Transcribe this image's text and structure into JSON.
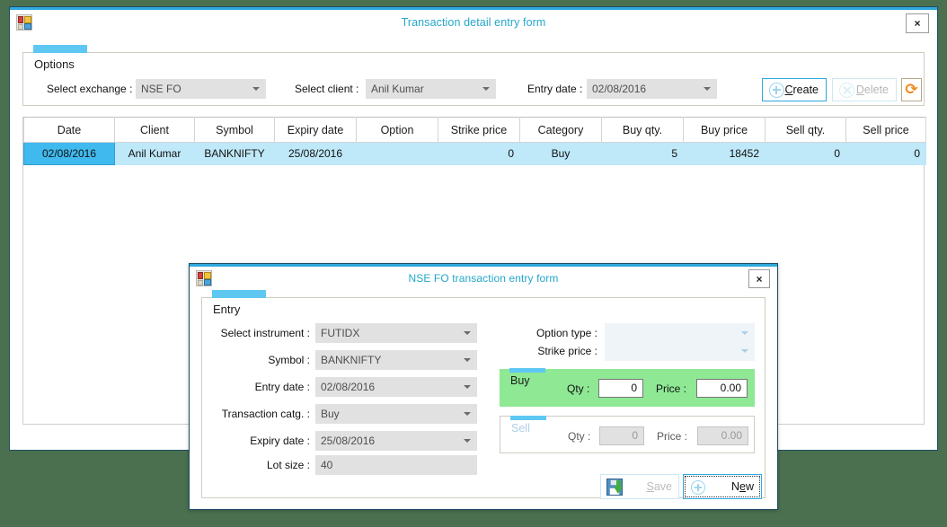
{
  "main_window": {
    "title": "Transaction detail entry form",
    "icon": "vb-form-icon",
    "close_label": "×",
    "options_panel": {
      "tab_label": "Options",
      "fields": [
        {
          "label": "Select exchange :",
          "value": "NSE FO"
        },
        {
          "label": "Select client :",
          "value": "Anil Kumar"
        },
        {
          "label": "Entry date :",
          "value": "02/08/2016"
        }
      ],
      "buttons": {
        "create": {
          "label_pre": "",
          "label_mnemonic": "C",
          "label_post": "reate",
          "icon": "plus-circle-icon"
        },
        "delete": {
          "label_pre": "",
          "label_mnemonic": "D",
          "label_post": "elete",
          "icon": "cross-circle-icon"
        },
        "refresh": {
          "icon": "refresh-icon",
          "glyph": "⟳"
        }
      }
    },
    "grid": {
      "columns": [
        "Date",
        "Client",
        "Symbol",
        "Expiry date",
        "Option",
        "Strike price",
        "Category",
        "Buy qty.",
        "Buy price",
        "Sell qty.",
        "Sell price"
      ],
      "rows": [
        {
          "date": "02/08/2016",
          "client": "Anil Kumar",
          "symbol": "BANKNIFTY",
          "expiry_date": "25/08/2016",
          "option": "",
          "strike_price": "0",
          "category": "Buy",
          "buy_qty": "5",
          "buy_price": "18452",
          "sell_qty": "0",
          "sell_price": "0"
        }
      ]
    }
  },
  "modal": {
    "title": "NSE FO transaction entry form",
    "icon": "vb-form-icon",
    "close_label": "×",
    "entry_panel": {
      "tab_label": "Entry",
      "left_fields": [
        {
          "label": "Select instrument :",
          "value": "FUTIDX"
        },
        {
          "label": "Symbol :",
          "value": "BANKNIFTY"
        },
        {
          "label": "Entry date :",
          "value": "02/08/2016"
        },
        {
          "label": "Transaction catg. :",
          "value": "Buy"
        },
        {
          "label": "Expiry date :",
          "value": "25/08/2016"
        },
        {
          "label": "Lot size :",
          "value": "40"
        }
      ],
      "right_fields": [
        {
          "label": "Option type :",
          "value": ""
        },
        {
          "label": "Strike price :",
          "value": ""
        }
      ],
      "buy_group": {
        "title": "Buy",
        "qty_label": "Qty :",
        "qty_value": "0",
        "price_label": "Price :",
        "price_value": "0.00"
      },
      "sell_group": {
        "title": "Sell",
        "qty_label": "Qty :",
        "qty_value": "0",
        "price_label": "Price :",
        "price_value": "0.00"
      }
    },
    "buttons": {
      "save": {
        "label_mnemonic": "S",
        "label_post": "ave",
        "icon": "save-floppy-icon"
      },
      "new": {
        "label_pre": "N",
        "label_mnemonic": "e",
        "label_post": "w",
        "icon": "plus-circle-icon"
      }
    }
  },
  "colors": {
    "desktop": "#4a7050",
    "title_text": "#25a6c9",
    "tab_accent": "#5ec8f2",
    "accent_border": "#2fa8dd",
    "grid_row": "#bfe8f9",
    "grid_selected_cell": "#3fb9ee",
    "buy_panel": "#8ee894",
    "refresh_icon": "#f08a1c"
  }
}
